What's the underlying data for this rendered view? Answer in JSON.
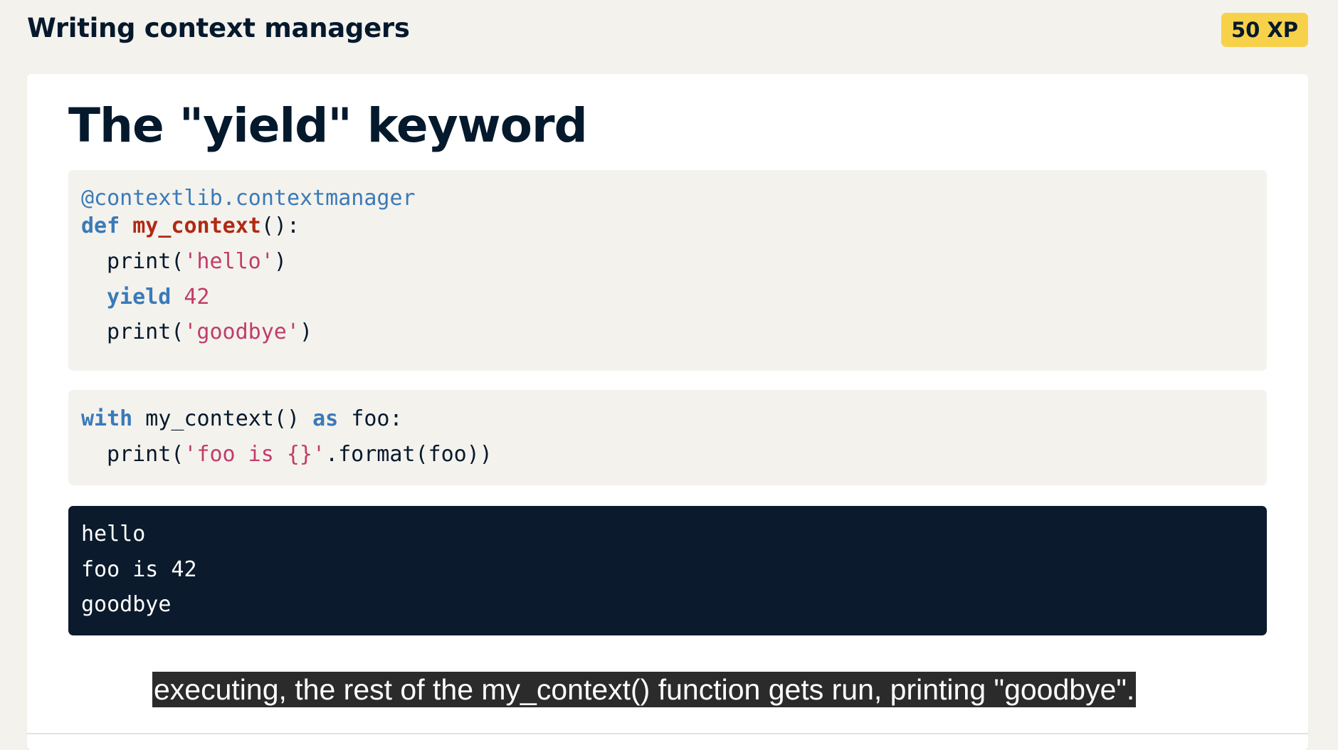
{
  "header": {
    "title": "Writing context managers",
    "xp_badge": "50 XP"
  },
  "slide": {
    "title": "The \"yield\" keyword"
  },
  "code": {
    "decorator": "@contextlib.contextmanager",
    "def_kw": "def",
    "func_name": "my_context",
    "func_sig_tail": "():",
    "print_open": "print(",
    "hello_str": "'hello'",
    "close_paren": ")",
    "yield_kw": "yield",
    "yield_value": "42",
    "goodbye_str": "'goodbye'",
    "with_kw": "with",
    "with_call": " my_context() ",
    "as_kw": "as",
    "with_target": " foo:",
    "format_str": "'foo is {}'",
    "format_tail": ".format(foo))"
  },
  "output": {
    "lines": [
      "hello",
      "foo is 42",
      "goodbye"
    ]
  },
  "subtitle": {
    "text": "executing, the rest of the my_context() function gets run, printing \"goodbye\"."
  },
  "colors": {
    "badge": "#f7d14a",
    "keyword": "#3a7ab8",
    "function_name": "#b02a14",
    "string": "#c13c6b",
    "output_bg": "#0b1a2c"
  }
}
